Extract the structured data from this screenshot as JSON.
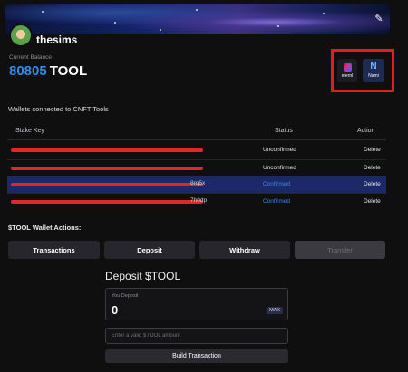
{
  "profile": {
    "username": "thesims",
    "balance_label": "Current Balance",
    "balance_value": "80805",
    "balance_unit": "TOOL"
  },
  "wallets": [
    {
      "label": "eternl",
      "icon": "eternl-wallet-icon"
    },
    {
      "label": "Nami",
      "icon": "nami-wallet-icon"
    }
  ],
  "colors": {
    "accent": "#2f8de4",
    "highlight": "#e11d1d",
    "selected_row": "#1b2a66"
  },
  "table": {
    "title": "Wallets connected to CNFT Tools",
    "headers": {
      "key": "Stake Key",
      "status": "Status",
      "action": "Action"
    },
    "rows": [
      {
        "tail": "",
        "status": "Unconfirmed",
        "action": "Delete"
      },
      {
        "tail": "",
        "status": "Unconfirmed",
        "action": "Delete"
      },
      {
        "tail": "8rq5x",
        "status": "Confirmed",
        "action": "Delete"
      },
      {
        "tail": "7h0dp",
        "status": "Confirmed",
        "action": "Delete"
      }
    ]
  },
  "actions": {
    "title": "$TOOL Wallet Actions:",
    "transactions": "Transactions",
    "deposit": "Deposit",
    "withdraw": "Withdraw",
    "transfer": "Transfer"
  },
  "deposit": {
    "title": "Deposit $TOOL",
    "you_deposit_label": "You Deposit",
    "amount": "0",
    "max_label": "MAX",
    "input_placeholder": "Enter a valid $TOOL amount",
    "build_button": "Build Transaction"
  }
}
